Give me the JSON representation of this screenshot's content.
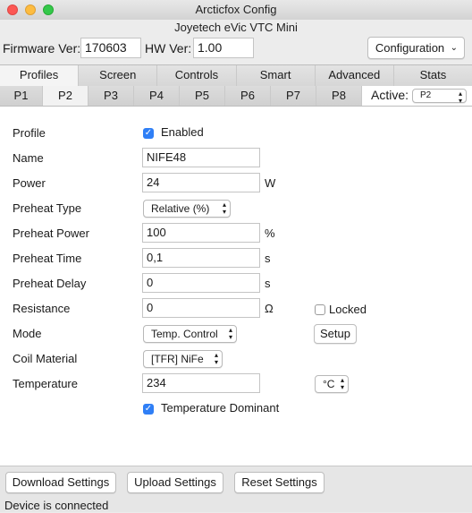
{
  "window": {
    "title": "Arcticfox Config",
    "subtitle": "Joyetech eVic VTC Mini"
  },
  "header": {
    "firmware_label": "Firmware Ver:",
    "firmware_value": "170603",
    "hw_label": "HW Ver:",
    "hw_value": "1.00",
    "config_button": "Configuration"
  },
  "main_tabs": [
    "Profiles",
    "Screen",
    "Controls",
    "Smart",
    "Advanced",
    "Stats"
  ],
  "profile_tabs": [
    "P1",
    "P2",
    "P3",
    "P4",
    "P5",
    "P6",
    "P7",
    "P8"
  ],
  "active": {
    "label": "Active:",
    "value": "P2"
  },
  "form": {
    "profile": {
      "label": "Profile",
      "check": "Enabled"
    },
    "name": {
      "label": "Name",
      "value": "NIFE48"
    },
    "power": {
      "label": "Power",
      "value": "24",
      "unit": "W"
    },
    "preheat_type": {
      "label": "Preheat Type",
      "value": "Relative (%)"
    },
    "preheat_power": {
      "label": "Preheat Power",
      "value": "100",
      "unit": "%"
    },
    "preheat_time": {
      "label": "Preheat Time",
      "value": "0,1",
      "unit": "s"
    },
    "preheat_delay": {
      "label": "Preheat Delay",
      "value": "0",
      "unit": "s"
    },
    "resistance": {
      "label": "Resistance",
      "value": "0",
      "unit": "Ω",
      "locked_label": "Locked"
    },
    "mode": {
      "label": "Mode",
      "value": "Temp. Control",
      "setup": "Setup"
    },
    "coil_material": {
      "label": "Coil Material",
      "value": "[TFR] NiFe"
    },
    "temperature": {
      "label": "Temperature",
      "value": "234",
      "unit": "°C"
    },
    "temp_dominant": "Temperature Dominant"
  },
  "footer": {
    "download": "Download Settings",
    "upload": "Upload Settings",
    "reset": "Reset Settings",
    "status": "Device is connected"
  }
}
